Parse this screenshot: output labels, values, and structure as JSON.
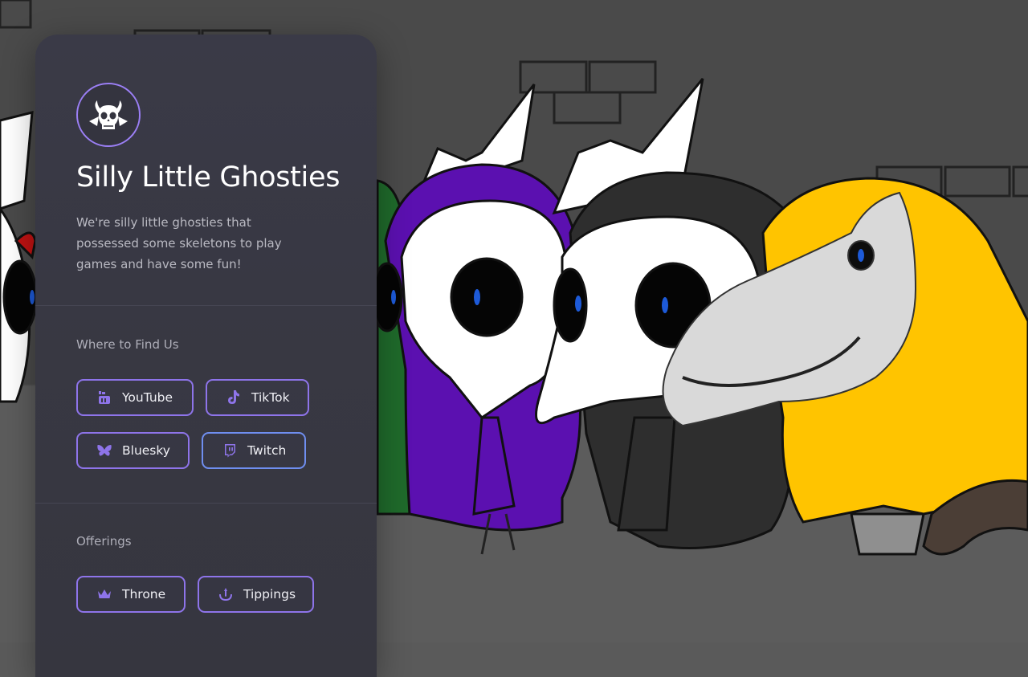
{
  "profile": {
    "title": "Silly Little Ghosties",
    "description": "We're silly little ghosties that possessed some skeletons to play games and have some fun!"
  },
  "sections": {
    "find_us": {
      "label": "Where to Find Us",
      "links": [
        {
          "label": "YouTube",
          "icon": "youtube-icon"
        },
        {
          "label": "TikTok",
          "icon": "tiktok-icon"
        },
        {
          "label": "Bluesky",
          "icon": "bluesky-icon"
        },
        {
          "label": "Twitch",
          "icon": "twitch-icon"
        }
      ]
    },
    "offerings": {
      "label": "Offerings",
      "links": [
        {
          "label": "Throne",
          "icon": "crown-icon"
        },
        {
          "label": "Tippings",
          "icon": "tip-jar-icon"
        }
      ]
    }
  },
  "colors": {
    "accent": "#8e74ea",
    "twitch_border": "#6f8ef0",
    "card_bg": "#383843",
    "ghost_purple": "#5b10b0",
    "ghost_yellow": "#ffc400",
    "ghost_black": "#2e2e2e",
    "ghost_green": "#1d6b2a"
  }
}
